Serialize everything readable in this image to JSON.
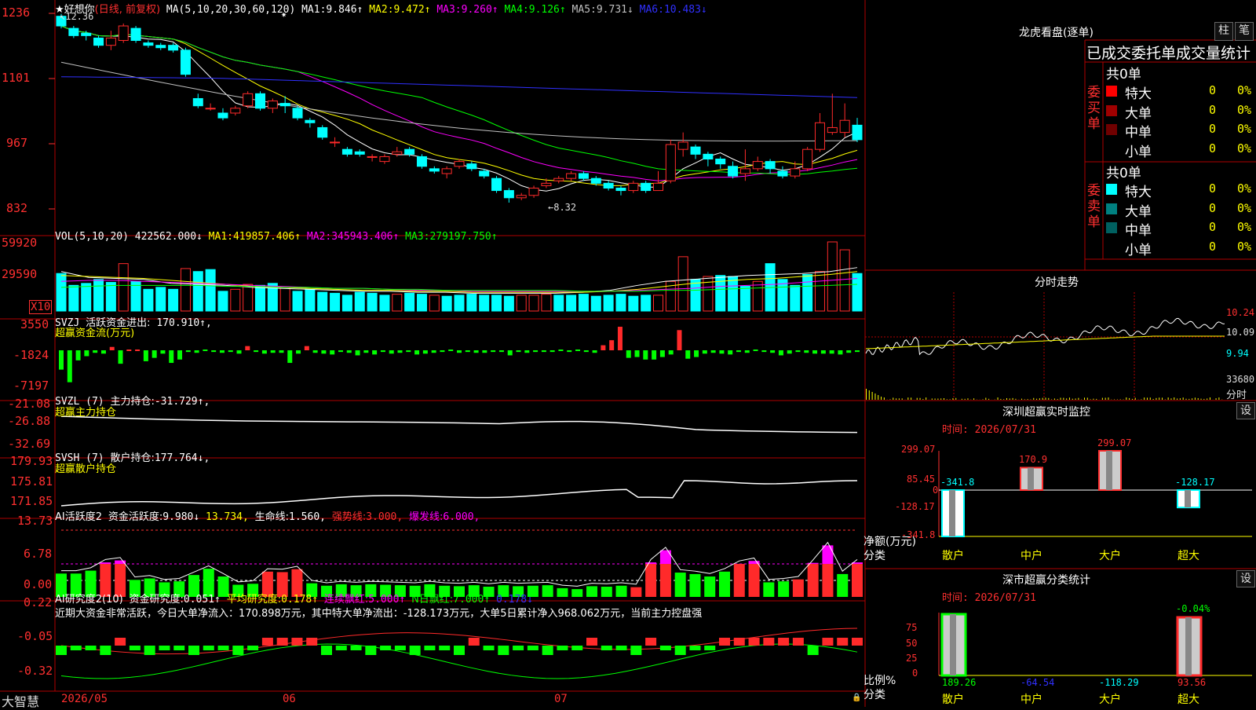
{
  "colors": {
    "up": "#ff2a2a",
    "down": "#00ffff",
    "vol_up": "#ff2a2a",
    "grid": "#b00000",
    "text": "#c0c0c0",
    "ma1": "#ffffff",
    "ma2": "#ffff00",
    "ma3": "#ff00ff",
    "ma4": "#00ff00",
    "ma5": "#c0c0c0",
    "ma6": "#3030ff"
  },
  "main": {
    "title": "★好想你",
    "period": "(日线, 前复权)",
    "ma_params": "MA(5,10,20,30,60,120)",
    "ma": [
      {
        "label": "MA1:",
        "value": "9.846↑"
      },
      {
        "label": "MA2:",
        "value": "9.472↑"
      },
      {
        "label": "MA3:",
        "value": "9.260↑"
      },
      {
        "label": "MA4:",
        "value": "9.126↑"
      },
      {
        "label": "MA5:",
        "value": "9.731↓"
      },
      {
        "label": "MA6:",
        "value": "10.483↓"
      }
    ],
    "y_ticks": [
      "1236",
      "1101",
      "967",
      "832"
    ],
    "high_label": "12.36",
    "low_label": "8.32",
    "star": "✷"
  },
  "candles": [
    [
      12.3,
      12.1,
      12.35,
      12.05
    ],
    [
      12.05,
      11.9,
      12.1,
      11.85
    ],
    [
      11.95,
      11.9,
      12.0,
      11.8
    ],
    [
      11.85,
      11.7,
      11.9,
      11.65
    ],
    [
      11.7,
      11.85,
      12.0,
      11.6
    ],
    [
      11.8,
      12.1,
      12.15,
      11.75
    ],
    [
      12.05,
      11.8,
      12.1,
      11.75
    ],
    [
      11.75,
      11.7,
      11.8,
      11.65
    ],
    [
      11.7,
      11.65,
      11.75,
      11.6
    ],
    [
      11.7,
      11.6,
      11.75,
      11.55
    ],
    [
      11.6,
      11.1,
      11.65,
      11.05
    ],
    [
      10.6,
      10.45,
      10.7,
      10.4
    ],
    [
      10.4,
      10.4,
      10.5,
      10.35
    ],
    [
      10.3,
      10.2,
      10.4,
      10.15
    ],
    [
      10.3,
      10.4,
      10.45,
      10.25
    ],
    [
      10.45,
      10.7,
      10.75,
      10.4
    ],
    [
      10.7,
      10.4,
      10.75,
      10.35
    ],
    [
      10.4,
      10.55,
      10.6,
      10.3
    ],
    [
      10.5,
      10.45,
      10.65,
      10.3
    ],
    [
      10.4,
      10.2,
      10.45,
      10.15
    ],
    [
      10.15,
      10.1,
      10.2,
      10.0
    ],
    [
      10.0,
      9.8,
      10.05,
      9.75
    ],
    [
      9.7,
      9.7,
      9.8,
      9.6
    ],
    [
      9.55,
      9.45,
      9.6,
      9.4
    ],
    [
      9.5,
      9.45,
      9.55,
      9.4
    ],
    [
      9.4,
      9.4,
      9.45,
      9.3
    ],
    [
      9.3,
      9.4,
      9.45,
      9.25
    ],
    [
      9.45,
      9.5,
      9.6,
      9.4
    ],
    [
      9.55,
      9.45,
      9.6,
      9.4
    ],
    [
      9.4,
      9.2,
      9.45,
      9.15
    ],
    [
      9.15,
      9.1,
      9.2,
      9.05
    ],
    [
      9.05,
      9.15,
      9.2,
      8.95
    ],
    [
      9.2,
      9.3,
      9.35,
      9.15
    ],
    [
      9.25,
      9.15,
      9.3,
      9.1
    ],
    [
      9.1,
      9.0,
      9.15,
      8.95
    ],
    [
      8.95,
      8.7,
      9.0,
      8.65
    ],
    [
      8.7,
      8.55,
      8.75,
      8.45
    ],
    [
      8.55,
      8.6,
      8.65,
      8.5
    ],
    [
      8.6,
      8.75,
      8.8,
      8.55
    ],
    [
      8.8,
      8.85,
      8.95,
      8.75
    ],
    [
      8.9,
      8.95,
      9.0,
      8.85
    ],
    [
      8.95,
      9.05,
      9.1,
      8.9
    ],
    [
      9.05,
      8.95,
      9.1,
      8.9
    ],
    [
      8.95,
      8.85,
      9.0,
      8.8
    ],
    [
      8.85,
      8.75,
      8.9,
      8.7
    ],
    [
      8.75,
      8.7,
      8.8,
      8.6
    ],
    [
      8.7,
      8.85,
      8.9,
      8.65
    ],
    [
      8.85,
      8.7,
      8.9,
      8.65
    ],
    [
      8.7,
      8.85,
      9.1,
      8.7
    ],
    [
      8.9,
      9.65,
      9.75,
      8.85
    ],
    [
      9.55,
      9.7,
      9.9,
      9.4
    ],
    [
      9.6,
      9.45,
      9.65,
      9.35
    ],
    [
      9.45,
      9.35,
      9.5,
      9.2
    ],
    [
      9.35,
      9.25,
      9.4,
      9.15
    ],
    [
      9.2,
      9.0,
      9.3,
      8.95
    ],
    [
      9.05,
      9.15,
      9.55,
      8.9
    ],
    [
      9.15,
      9.3,
      9.4,
      9.1
    ],
    [
      9.3,
      9.15,
      9.35,
      9.05
    ],
    [
      9.1,
      9.0,
      9.2,
      8.95
    ],
    [
      9.0,
      9.15,
      9.3,
      8.95
    ],
    [
      9.15,
      9.55,
      9.6,
      9.1
    ],
    [
      9.55,
      10.1,
      10.3,
      9.5
    ],
    [
      9.9,
      10.0,
      10.7,
      9.85
    ],
    [
      9.9,
      10.15,
      10.5,
      9.8
    ],
    [
      10.05,
      9.75,
      10.2,
      9.7
    ]
  ],
  "vol": {
    "params": "VOL(5,10,20)",
    "value": "422562.000↓",
    "ma": [
      {
        "label": "MA1:",
        "value": "419857.406↑"
      },
      {
        "label": "MA2:",
        "value": "345943.406↑"
      },
      {
        "label": "MA3:",
        "value": "279197.750↑"
      }
    ],
    "y_ticks": [
      "59920",
      "29590"
    ],
    "unit": "X10",
    "bars": [
      38,
      26,
      28,
      32,
      29,
      48,
      30,
      22,
      24,
      22,
      43,
      40,
      42,
      20,
      22,
      27,
      26,
      28,
      24,
      20,
      22,
      19,
      18,
      16,
      19,
      18,
      16,
      17,
      18,
      17,
      16,
      15,
      16,
      17,
      16,
      16,
      15,
      16,
      16,
      17,
      16,
      16,
      17,
      15,
      16,
      17,
      15,
      16,
      16,
      30,
      55,
      32,
      35,
      36,
      35,
      25,
      30,
      48,
      32,
      26,
      37,
      40,
      70,
      62,
      38
    ]
  },
  "svzj": {
    "name": "SVZJ",
    "label": "活跃资金进出:",
    "value": "170.910↑,",
    "sub": "超赢资金流(万元)",
    "y_ticks": [
      "3550",
      "-1824",
      "-7197"
    ],
    "bars": [
      -2300,
      -3800,
      -1200,
      -700,
      -300,
      -400,
      400,
      -1600,
      0,
      0,
      -1300,
      -900,
      -400,
      -1500,
      -1100,
      -200,
      -300,
      -100,
      -200,
      -300,
      -200,
      -400,
      500,
      -200,
      -400,
      -300,
      -300,
      -1500,
      -400,
      500,
      -300,
      -400,
      -500,
      -200,
      -300,
      -600,
      -300,
      -500,
      -200,
      -400,
      -300,
      -200,
      -500,
      -400,
      -300,
      -200,
      -100,
      -300,
      -200,
      -300,
      -300,
      -200,
      -200,
      -600,
      -200,
      -300,
      -200,
      -200,
      -200,
      -100,
      -200,
      -100,
      -200,
      -300,
      600,
      1200,
      2800,
      -900,
      -800,
      -1100,
      -1100,
      -800,
      -500,
      2400,
      -1000,
      -800,
      -400,
      -300,
      -400,
      -500,
      -200,
      -300,
      -100,
      -200,
      -300,
      -600,
      -400,
      -200,
      -300,
      -400,
      -400,
      -400,
      -500,
      -300,
      -200
    ]
  },
  "svzl": {
    "name": "SVZL",
    "params": "(7)",
    "label": "主力持仓:",
    "value": "-31.729↑,",
    "sub": "超赢主力持仓",
    "y_ticks": [
      "-21.08",
      "-26.88",
      "-32.69"
    ]
  },
  "svsh": {
    "name": "SVSH",
    "params": "(7)",
    "label": "散户持仓:",
    "value": "177.764↓,",
    "sub": "超赢散户持仓",
    "y_ticks": [
      "179.93",
      "175.81",
      "171.85"
    ]
  },
  "ai_active": {
    "name": "AI活跃度2",
    "label": "资金活跃度:",
    "value": "9.980↓",
    "v2": "13.734,",
    "lifeline": "生命线:",
    "lifeline_value": "1.560,",
    "strong": "强势线:",
    "strong_value": "3.000,",
    "burst": "爆发线:",
    "burst_value": "6.000,",
    "y_ticks": [
      "13.73",
      "6.78",
      "0.00"
    ],
    "bars": [
      [
        4.8,
        0
      ],
      [
        4.8,
        0
      ],
      [
        5.4,
        0
      ],
      [
        0,
        7.1
      ],
      [
        0,
        7.5
      ],
      [
        3.5,
        0
      ],
      [
        3.8,
        0
      ],
      [
        3.0,
        0
      ],
      [
        3.2,
        0
      ],
      [
        4.5,
        0
      ],
      [
        5.8,
        0
      ],
      [
        4.2,
        0
      ],
      [
        2.5,
        0
      ],
      [
        2.7,
        0
      ],
      [
        0,
        5.2
      ],
      [
        0,
        5.1
      ],
      [
        0,
        5.7
      ],
      [
        2.8,
        0
      ],
      [
        2.3,
        0
      ],
      [
        2.6,
        0
      ],
      [
        2.4,
        0
      ],
      [
        2.6,
        0
      ],
      [
        2.5,
        0
      ],
      [
        2.4,
        0
      ],
      [
        2.3,
        0
      ],
      [
        2.6,
        0
      ],
      [
        2.3,
        0
      ],
      [
        2.2,
        0
      ],
      [
        2.4,
        0
      ],
      [
        2.1,
        0
      ],
      [
        2.4,
        0
      ],
      [
        2.2,
        0
      ],
      [
        2.3,
        0
      ],
      [
        2.4,
        0
      ],
      [
        1.8,
        0
      ],
      [
        1.6,
        0
      ],
      [
        2.2,
        0
      ],
      [
        2.1,
        0
      ],
      [
        2.3,
        0
      ],
      [
        0,
        2.0
      ],
      [
        0,
        7.1
      ],
      [
        0,
        9.6
      ],
      [
        5.0,
        0
      ],
      [
        4.7,
        0
      ],
      [
        4.2,
        0
      ],
      [
        5.2,
        0
      ],
      [
        0,
        6.8
      ],
      [
        0,
        7.4
      ],
      [
        3.0,
        0
      ],
      [
        3.2,
        0
      ],
      [
        0,
        3.6
      ],
      [
        0,
        7.0
      ],
      [
        0,
        10.6
      ],
      [
        4.7,
        0
      ],
      [
        0,
        7.1
      ]
    ]
  },
  "ai_research": {
    "name": "AI研究度2(10)",
    "label": "资金研究度:",
    "value": "0.051↑",
    "avg": "平均研究度:",
    "avg_value": "0.178↑",
    "streak": "连续飘红:",
    "streak_value": "5.000↑",
    "nday": "N日飘红:",
    "nday_value": "7.000↑",
    "last": "0.178↓",
    "y_ticks": [
      "0.22",
      "-0.05",
      "-0.32"
    ],
    "summary": "近期大资金非常活跃，今日大单净流入：170.898万元，其中特大单净流出：-128.173万元，大单5日累计净入968.062万元，当前主力控盘强"
  },
  "xaxis": {
    "labels": [
      "2026/05",
      "06",
      "07"
    ],
    "brand": "大智慧"
  },
  "right": {
    "dragon_title": "龙虎看盘(逐单)",
    "buttons": [
      "柱",
      "笔"
    ],
    "stats_title": "已成交委托单成交量统计",
    "buy": {
      "side": "委买单",
      "total": "共0单",
      "rows": [
        {
          "name": "特大",
          "count": "0",
          "pct": "0%",
          "color": "#ff0000"
        },
        {
          "name": "大单",
          "count": "0",
          "pct": "0%",
          "color": "#a00000"
        },
        {
          "name": "中单",
          "count": "0",
          "pct": "0%",
          "color": "#700000"
        },
        {
          "name": "小单",
          "count": "0",
          "pct": "0%",
          "color": "#000000"
        }
      ]
    },
    "sell": {
      "side": "委卖单",
      "total": "共0单",
      "rows": [
        {
          "name": "特大",
          "count": "0",
          "pct": "0%",
          "color": "#00ffff"
        },
        {
          "name": "大单",
          "count": "0",
          "pct": "0%",
          "color": "#008080"
        },
        {
          "name": "中单",
          "count": "0",
          "pct": "0%",
          "color": "#006060"
        },
        {
          "name": "小单",
          "count": "0",
          "pct": "0%",
          "color": "#000000"
        }
      ]
    },
    "intraday": {
      "title": "分时走势",
      "y_ticks": [
        "10.24",
        "10.09",
        "9.94",
        "33680"
      ],
      "unit": "分时"
    },
    "monitor": {
      "title": "深圳超赢实时监控",
      "button": "设",
      "time": "时间: 2026/07/31",
      "y_ticks": [
        "299.07",
        "85.45",
        "0",
        "-128.17",
        "-341.8"
      ],
      "ylabel": "净额(万元)",
      "xlabel": "分类",
      "categories": [
        "散户",
        "中户",
        "大户",
        "超大"
      ],
      "values": [
        -341.8,
        170.9,
        299.07,
        -128.17
      ],
      "value_labels": [
        "-341.8",
        "170.9",
        "299.07",
        "-128.17"
      ]
    },
    "classify": {
      "title": "深市超赢分类统计",
      "button": "设",
      "time": "时间: 2026/07/31",
      "y_ticks": [
        "75",
        "50",
        "25",
        "0"
      ],
      "ylabel": "比例%",
      "xlabel": "分类",
      "categories": [
        "散户",
        "中户",
        "大户",
        "超大"
      ],
      "values": [
        "189.26",
        "-64.54",
        "-118.29",
        "93.56"
      ],
      "top_label": "-0.04%"
    }
  }
}
